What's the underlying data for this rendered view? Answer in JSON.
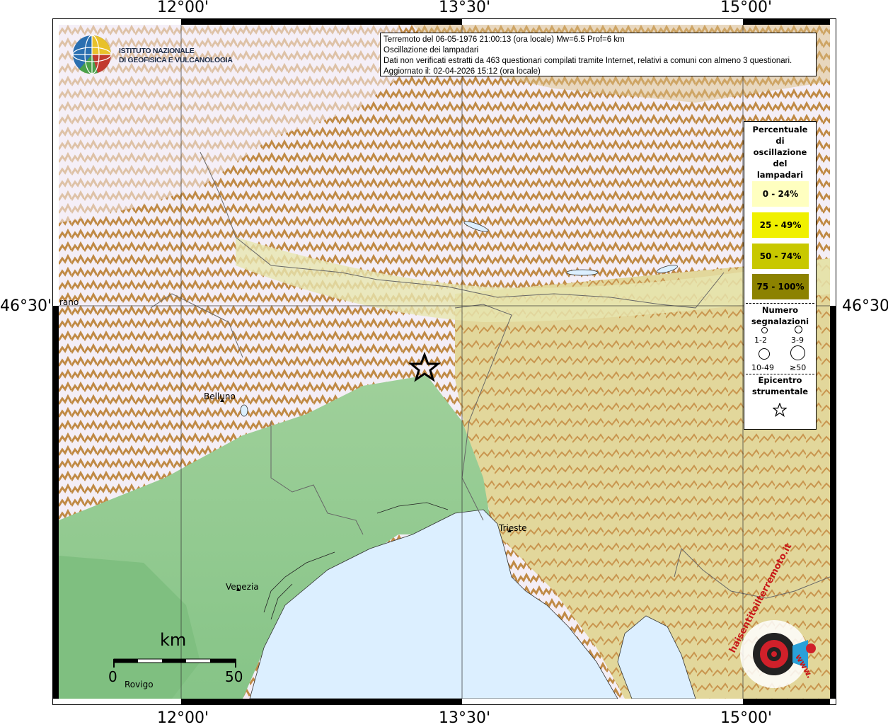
{
  "axes": {
    "lon_top": [
      "12°00'",
      "13°30'",
      "15°00'"
    ],
    "lon_bottom": [
      "12°00'",
      "13°30'",
      "15°00'"
    ],
    "lat_left": "46°30'",
    "lat_right": "46°30'"
  },
  "info_box": {
    "line1": "Terremoto del 06-05-1976 21:00:13 (ora locale) Mw=6.5 Prof=6 km",
    "line2": "Oscillazione dei lampadari",
    "line3": "Dati non verificati estratti da 463 questionari compilati tramite Internet, relativi a comuni con almeno 3 questionari.",
    "line4": "Aggiornato il: 02-04-2026 15:12 (ora locale)"
  },
  "logo": {
    "line1": "ISTITUTO NAZIONALE",
    "line2": "DI GEOFISICA E VULCANOLOGIA"
  },
  "legend": {
    "title": [
      "Percentuale",
      "di",
      "oscillazione",
      "del",
      "lampadari"
    ],
    "classes": [
      {
        "label": "0 - 24%",
        "color": "#ffffc0"
      },
      {
        "label": "25 - 49%",
        "color": "#f0f000"
      },
      {
        "label": "50 - 74%",
        "color": "#c8c800"
      },
      {
        "label": "75 - 100%",
        "color": "#8c8200"
      }
    ],
    "count_title": [
      "Numero",
      "segnalazioni"
    ],
    "count_classes": [
      "1-2",
      "3-9",
      "10-49",
      "≥50"
    ],
    "epicentre_title": [
      "Epicentro",
      "strumentale"
    ]
  },
  "places": {
    "belluno": "Belluno",
    "trieste": "Trieste",
    "venezia": "Venezia",
    "rovigo": "Rovigo",
    "bolzano_partial": "rano"
  },
  "scale": {
    "unit": "km",
    "start": "0",
    "end": "50"
  },
  "hsit_logo": {
    "text": "haisentitoilterremoto.it",
    "url": "www."
  },
  "colors": {
    "sea": "#dcefff",
    "plain": "#8fcc8f",
    "hills": "#e8dca0",
    "mountains": "#c8924a",
    "snow": "#f8f4fa"
  }
}
